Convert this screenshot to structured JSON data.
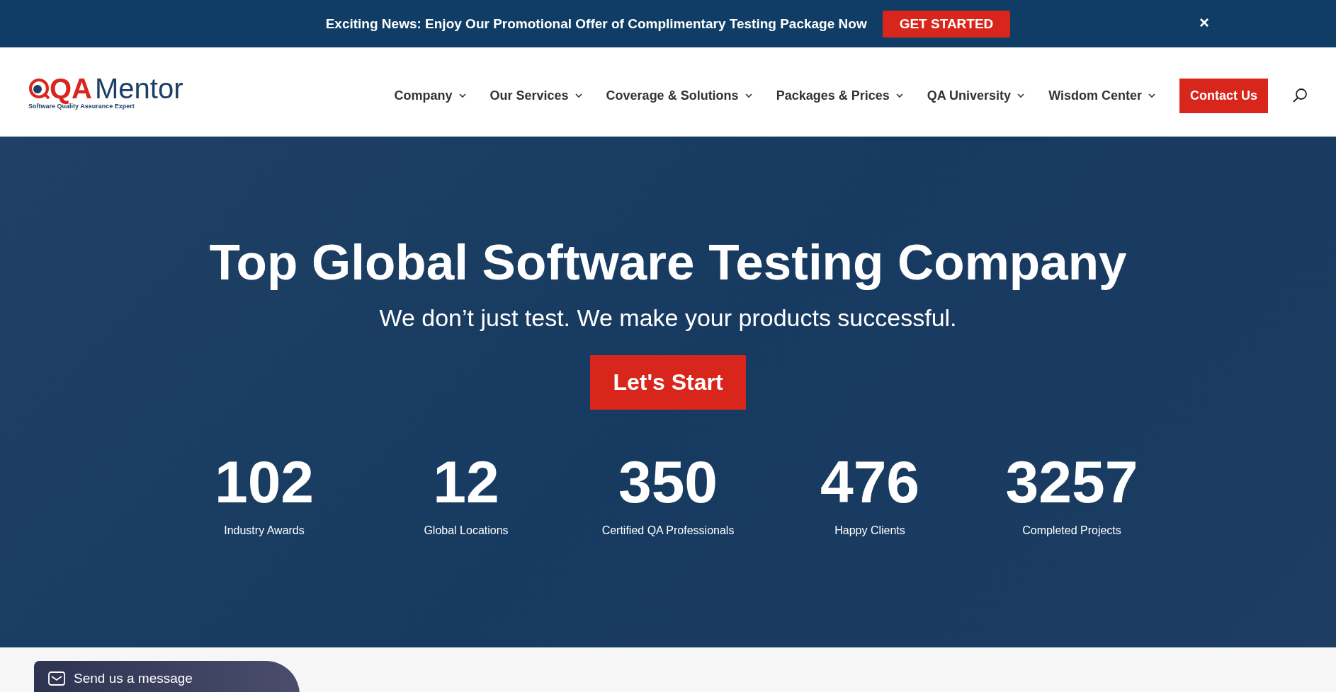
{
  "promo_bar": {
    "text": "Exciting News: Enjoy Our Promotional Offer of Complimentary Testing Package Now",
    "button": "GET STARTED",
    "close": "×"
  },
  "header": {
    "logo": {
      "letters": "QA",
      "name": "Mentor",
      "tagline": "Software Quality Assurance Expert"
    },
    "nav": [
      {
        "label": "Company",
        "dropdown": true
      },
      {
        "label": "Our Services",
        "dropdown": true
      },
      {
        "label": "Coverage & Solutions",
        "dropdown": true
      },
      {
        "label": "Packages & Prices",
        "dropdown": true
      },
      {
        "label": "QA University",
        "dropdown": true
      },
      {
        "label": "Wisdom Center",
        "dropdown": true
      }
    ],
    "contact_button": "Contact Us"
  },
  "hero": {
    "title": "Top Global Software Testing Company",
    "subtitle": "We don’t just test. We make your products successful.",
    "button": "Let's Start",
    "stats": [
      {
        "value": "102",
        "label": "Industry Awards"
      },
      {
        "value": "12",
        "label": "Global Locations"
      },
      {
        "value": "350",
        "label": "Certified QA Professionals"
      },
      {
        "value": "476",
        "label": "Happy Clients"
      },
      {
        "value": "3257",
        "label": "Completed Projects"
      }
    ]
  },
  "chat_widget": {
    "label": "Send us a message"
  }
}
